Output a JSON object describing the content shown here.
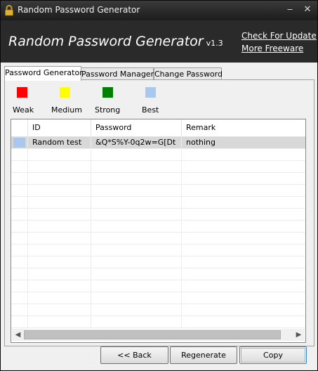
{
  "window": {
    "title": "Random Password Generator"
  },
  "banner": {
    "app_name": "Random Password Generator",
    "version": "v1.3",
    "link_update": "Check For Update",
    "link_freeware": "More Freeware"
  },
  "tabs": [
    {
      "label": "Password Generator",
      "active": true
    },
    {
      "label": "Password Manager",
      "active": false
    },
    {
      "label": "Change Password",
      "active": false
    }
  ],
  "legend": [
    {
      "label": "Weak",
      "color": "#ff0000"
    },
    {
      "label": "Medium",
      "color": "#ffff00"
    },
    {
      "label": "Strong",
      "color": "#008000"
    },
    {
      "label": "Best",
      "color": "#a8c8f0"
    }
  ],
  "table": {
    "headers": [
      "ID",
      "Password",
      "Remark"
    ],
    "rows": [
      {
        "id": "Random test",
        "password": "&Q*S%Y-0q2w=G[Dt",
        "remark": "nothing",
        "strength_color": "#a8c8f0"
      }
    ]
  },
  "buttons": {
    "back": "<< Back",
    "regenerate": "Regenerate",
    "copy": "Copy"
  }
}
